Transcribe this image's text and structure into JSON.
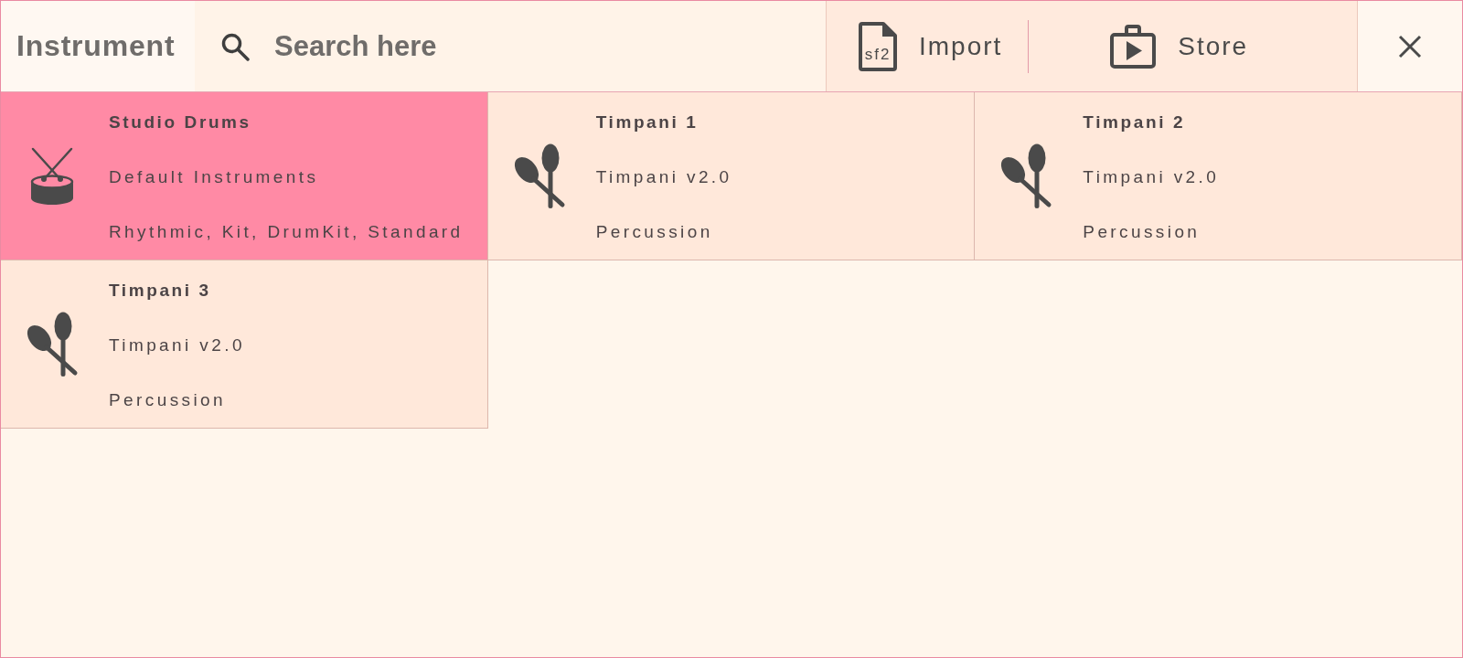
{
  "header": {
    "title": "Instrument",
    "search": {
      "placeholder": "Search here"
    },
    "actions": [
      {
        "kind": "import",
        "label": "Import",
        "icon_text": "sf2"
      },
      {
        "kind": "store",
        "label": "Store"
      }
    ]
  },
  "instruments": [
    {
      "kind": "drum",
      "name": "Studio Drums",
      "bank": "Default Instruments",
      "tags": "Rhythmic, Kit, DrumKit, Standard",
      "selected": true
    },
    {
      "kind": "maracas",
      "name": "Timpani 1",
      "bank": "Timpani v2.0",
      "tags": "Percussion",
      "selected": false
    },
    {
      "kind": "maracas",
      "name": "Timpani 2",
      "bank": "Timpani v2.0",
      "tags": "Percussion",
      "selected": false
    },
    {
      "kind": "maracas",
      "name": "Timpani 3",
      "bank": "Timpani v2.0",
      "tags": "Percussion",
      "selected": false
    }
  ]
}
